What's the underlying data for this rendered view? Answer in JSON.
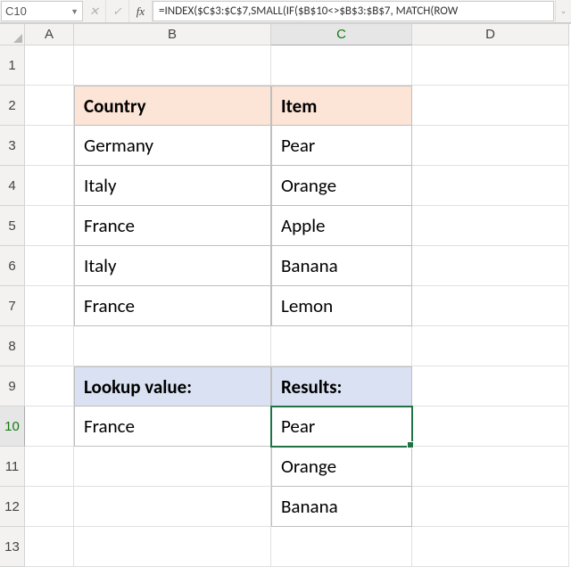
{
  "namebox": {
    "value": "C10"
  },
  "formula": "=INDEX($C$3:$C$7,SMALL(IF($B$10<>$B$3:$B$7, MATCH(ROW",
  "columns": [
    "A",
    "B",
    "C",
    "D"
  ],
  "rows": [
    "1",
    "2",
    "3",
    "4",
    "5",
    "6",
    "7",
    "8",
    "9",
    "10",
    "11",
    "12",
    "13"
  ],
  "table1": {
    "headers": {
      "country": "Country",
      "item": "Item"
    },
    "rows": [
      {
        "country": "Germany",
        "item": "Pear"
      },
      {
        "country": "Italy",
        "item": "Orange"
      },
      {
        "country": "France",
        "item": "Apple"
      },
      {
        "country": "Italy",
        "item": "Banana"
      },
      {
        "country": "France",
        "item": "Lemon"
      }
    ]
  },
  "table2": {
    "headers": {
      "lookup": "Lookup value:",
      "results": "Results:"
    },
    "lookup_value": "France",
    "results": [
      "Pear",
      "Orange",
      "Banana"
    ]
  },
  "selected_cell": "C10"
}
